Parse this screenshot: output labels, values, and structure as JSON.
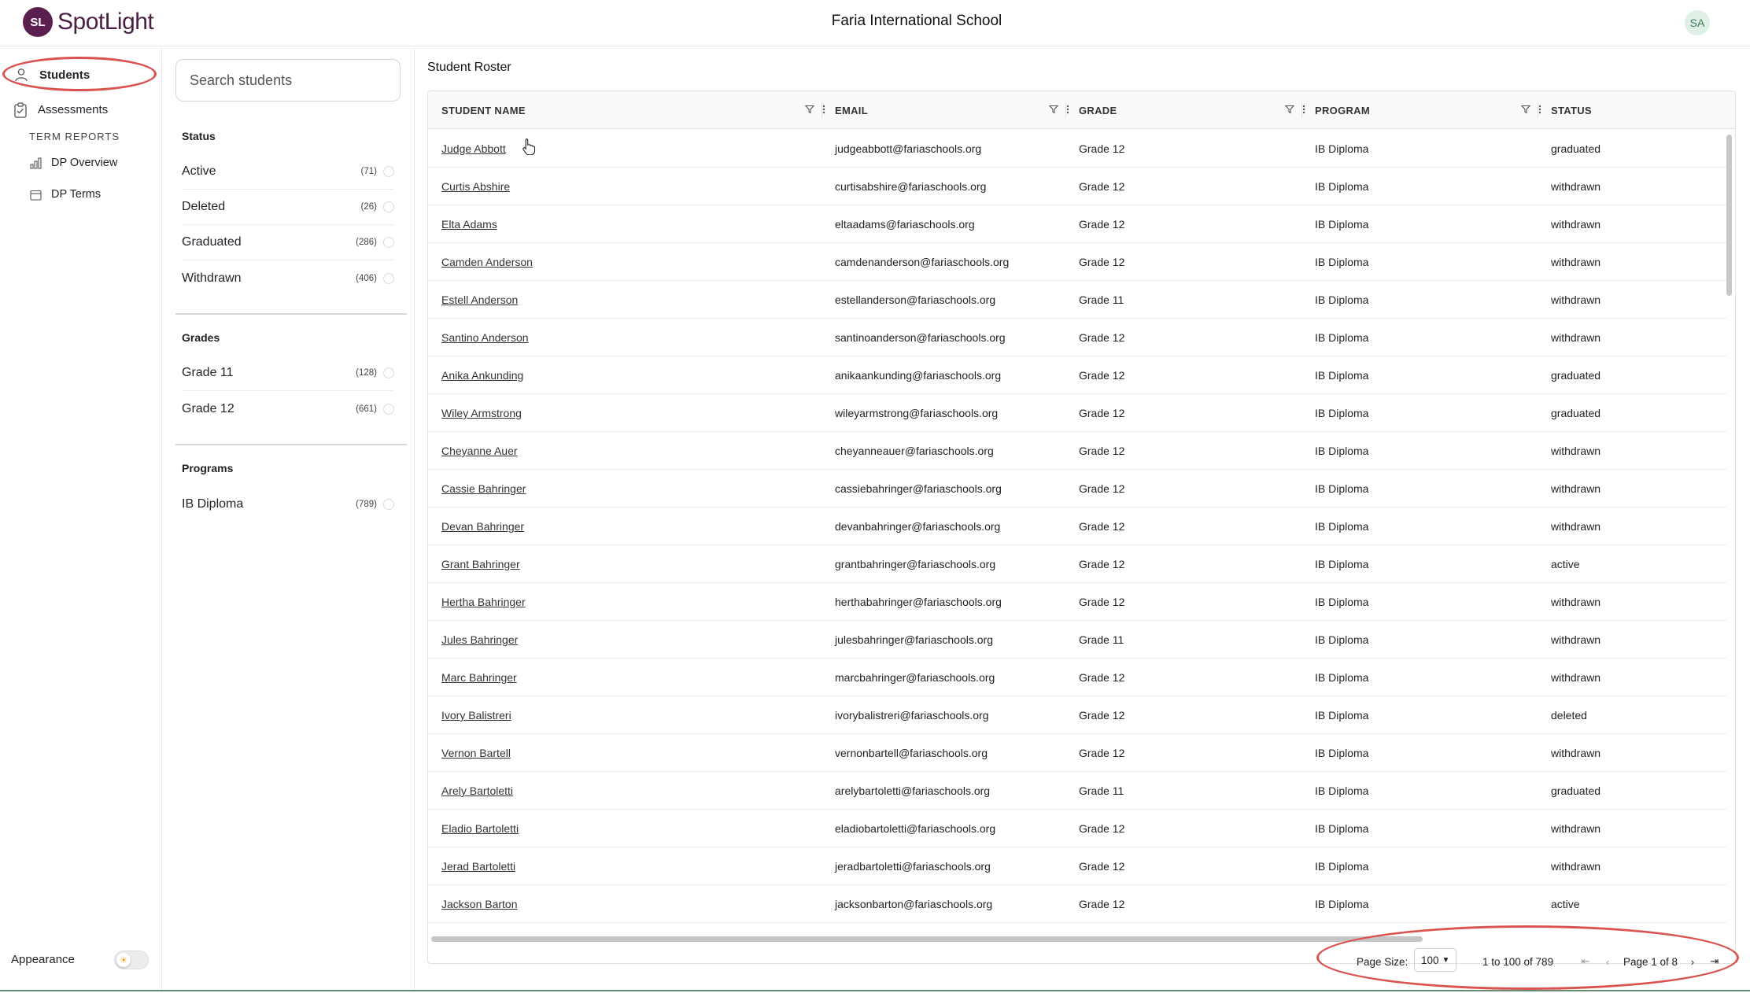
{
  "brand": {
    "logo_initials": "SL",
    "name": "SpotLight",
    "color": "#5b1f4f"
  },
  "header": {
    "school": "Faria International School",
    "avatar_initials": "SA"
  },
  "nav": {
    "students": "Students",
    "assessments": "Assessments",
    "section": "TERM REPORTS",
    "dp_overview": "DP Overview",
    "dp_terms": "DP Terms",
    "appearance": "Appearance"
  },
  "filters": {
    "search_placeholder": "Search students",
    "status": {
      "title": "Status",
      "items": [
        {
          "label": "Active",
          "count": "(71)"
        },
        {
          "label": "Deleted",
          "count": "(26)"
        },
        {
          "label": "Graduated",
          "count": "(286)"
        },
        {
          "label": "Withdrawn",
          "count": "(406)"
        }
      ]
    },
    "grades": {
      "title": "Grades",
      "items": [
        {
          "label": "Grade 11",
          "count": "(128)"
        },
        {
          "label": "Grade 12",
          "count": "(661)"
        }
      ]
    },
    "programs": {
      "title": "Programs",
      "items": [
        {
          "label": "IB Diploma",
          "count": "(789)"
        }
      ]
    }
  },
  "roster": {
    "title": "Student Roster",
    "columns": [
      "STUDENT NAME",
      "EMAIL",
      "GRADE",
      "PROGRAM",
      "STATUS"
    ],
    "rows": [
      [
        "Judge Abbott",
        "judgeabbott@fariaschools.org",
        "Grade 12",
        "IB Diploma",
        "graduated"
      ],
      [
        "Curtis Abshire",
        "curtisabshire@fariaschools.org",
        "Grade 12",
        "IB Diploma",
        "withdrawn"
      ],
      [
        "Elta Adams",
        "eltaadams@fariaschools.org",
        "Grade 12",
        "IB Diploma",
        "withdrawn"
      ],
      [
        "Camden Anderson",
        "camdenanderson@fariaschools.org",
        "Grade 12",
        "IB Diploma",
        "withdrawn"
      ],
      [
        "Estell Anderson",
        "estellanderson@fariaschools.org",
        "Grade 11",
        "IB Diploma",
        "withdrawn"
      ],
      [
        "Santino Anderson",
        "santinoanderson@fariaschools.org",
        "Grade 12",
        "IB Diploma",
        "withdrawn"
      ],
      [
        "Anika Ankunding",
        "anikaankunding@fariaschools.org",
        "Grade 12",
        "IB Diploma",
        "graduated"
      ],
      [
        "Wiley Armstrong",
        "wileyarmstrong@fariaschools.org",
        "Grade 12",
        "IB Diploma",
        "graduated"
      ],
      [
        "Cheyanne Auer",
        "cheyanneauer@fariaschools.org",
        "Grade 12",
        "IB Diploma",
        "withdrawn"
      ],
      [
        "Cassie Bahringer",
        "cassiebahringer@fariaschools.org",
        "Grade 12",
        "IB Diploma",
        "withdrawn"
      ],
      [
        "Devan Bahringer",
        "devanbahringer@fariaschools.org",
        "Grade 12",
        "IB Diploma",
        "withdrawn"
      ],
      [
        "Grant Bahringer",
        "grantbahringer@fariaschools.org",
        "Grade 12",
        "IB Diploma",
        "active"
      ],
      [
        "Hertha Bahringer",
        "herthabahringer@fariaschools.org",
        "Grade 12",
        "IB Diploma",
        "withdrawn"
      ],
      [
        "Jules Bahringer",
        "julesbahringer@fariaschools.org",
        "Grade 11",
        "IB Diploma",
        "withdrawn"
      ],
      [
        "Marc Bahringer",
        "marcbahringer@fariaschools.org",
        "Grade 12",
        "IB Diploma",
        "withdrawn"
      ],
      [
        "Ivory Balistreri",
        "ivorybalistreri@fariaschools.org",
        "Grade 12",
        "IB Diploma",
        "deleted"
      ],
      [
        "Vernon Bartell",
        "vernonbartell@fariaschools.org",
        "Grade 12",
        "IB Diploma",
        "withdrawn"
      ],
      [
        "Arely Bartoletti",
        "arelybartoletti@fariaschools.org",
        "Grade 11",
        "IB Diploma",
        "graduated"
      ],
      [
        "Eladio Bartoletti",
        "eladiobartoletti@fariaschools.org",
        "Grade 12",
        "IB Diploma",
        "withdrawn"
      ],
      [
        "Jerad Bartoletti",
        "jeradbartoletti@fariaschools.org",
        "Grade 12",
        "IB Diploma",
        "withdrawn"
      ],
      [
        "Jackson Barton",
        "jacksonbarton@fariaschools.org",
        "Grade 12",
        "IB Diploma",
        "active"
      ]
    ]
  },
  "pagination": {
    "page_size_label": "Page Size:",
    "page_size": "100",
    "row_range": "1 to 100 of 789",
    "page_label": "Page 1 of 8"
  },
  "colors": {
    "highlight": "#d9534f",
    "avatar_bg": "#dff0e6"
  }
}
